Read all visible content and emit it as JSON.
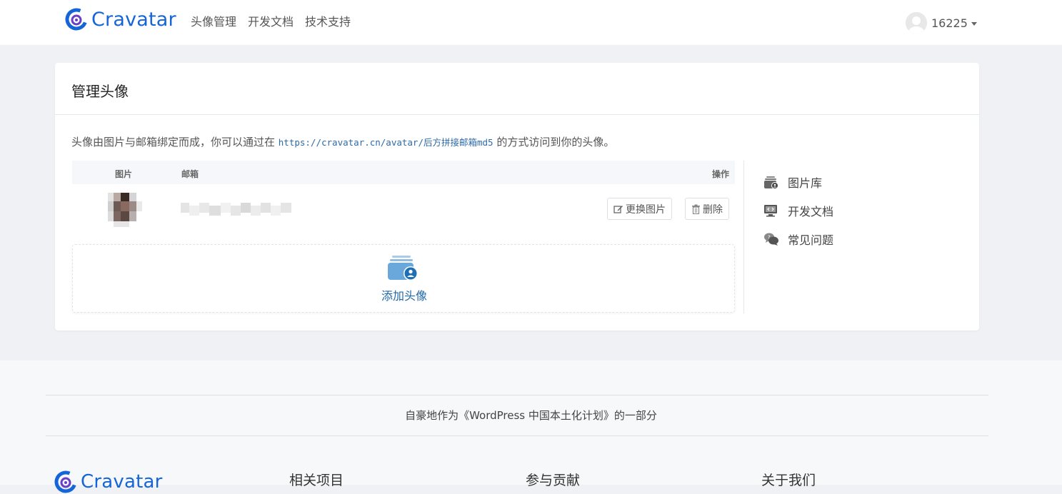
{
  "header": {
    "brand": "Cravatar",
    "nav": [
      "头像管理",
      "开发文档",
      "技术支持"
    ],
    "user": "16225"
  },
  "card": {
    "title": "管理头像",
    "intro_prefix": "头像由图片与邮箱绑定而成，你可以通过在 ",
    "intro_code": "https://cravatar.cn/avatar/后方拼接邮箱md5",
    "intro_suffix": " 的方式访问到你的头像。",
    "table": {
      "col_image": "图片",
      "col_email": "邮箱",
      "col_ops": "操作",
      "btn_change": "更换图片",
      "btn_delete": "删除"
    },
    "add_label": "添加头像"
  },
  "sidebar": {
    "items": [
      "图片库",
      "开发文档",
      "常见问题"
    ]
  },
  "footer": {
    "tagline": "自豪地作为《WordPress 中国本土化计划》的一部分",
    "brand": "Cravatar",
    "columns": [
      "相关项目",
      "参与贡献",
      "关于我们"
    ]
  },
  "colors": {
    "brand": "#1565d8",
    "link": "#2168a8"
  }
}
